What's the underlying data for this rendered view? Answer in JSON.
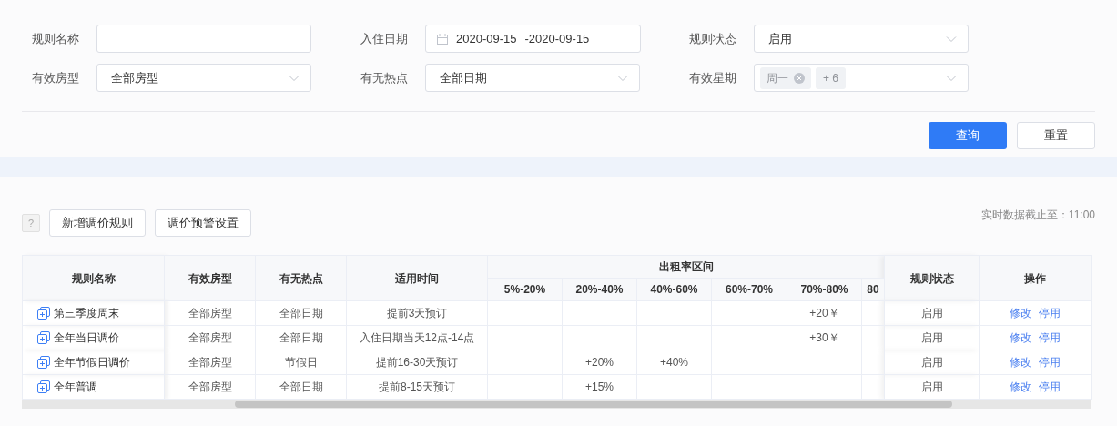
{
  "filters": [
    {
      "label": "规则名称",
      "kind": "text"
    },
    {
      "label": "入住日期",
      "kind": "daterange",
      "start": "2020-09-15",
      "separator": "-",
      "end": "2020-09-15"
    },
    {
      "label": "规则状态",
      "kind": "select",
      "value": "启用"
    },
    {
      "label": "有效房型",
      "kind": "select",
      "value": "全部房型"
    },
    {
      "label": "有无热点",
      "kind": "select",
      "value": "全部日期"
    },
    {
      "label": "有效星期",
      "kind": "tags",
      "tags": [
        "周一"
      ],
      "more": "+ 6"
    }
  ],
  "search_buttons": [
    {
      "label": "查询",
      "primary": true
    },
    {
      "label": "重置",
      "primary": false
    }
  ],
  "toolbar": {
    "help": "?",
    "buttons": [
      "新增调价规则",
      "调价预警设置"
    ],
    "timestamp": "实时数据截止至：11:00"
  },
  "table": {
    "left_columns": [
      "规则名称",
      "有效房型",
      "有无热点",
      "适用时间"
    ],
    "group": {
      "label": "出租率区间",
      "columns": [
        "5%-20%",
        "20%-40%",
        "40%-60%",
        "60%-70%",
        "70%-80%",
        "80"
      ]
    },
    "right_columns": [
      "规则状态",
      "操作"
    ],
    "rows": [
      {
        "name": "第三季度周末",
        "room_type": "全部房型",
        "hotspot": "全部日期",
        "time": "提前3天预订",
        "rates": {
          "col_5": "+20￥"
        },
        "status": "启用",
        "actions": [
          "修改",
          "停用"
        ]
      },
      {
        "name": "全年当日调价",
        "room_type": "全部房型",
        "hotspot": "全部日期",
        "time": "入住日期当天12点-14点",
        "rates": {
          "col_5": "+30￥"
        },
        "status": "启用",
        "actions": [
          "修改",
          "停用"
        ]
      },
      {
        "name": "全年节假日调价",
        "room_type": "全部房型",
        "hotspot": "节假日",
        "time": "提前16-30天预订",
        "rates": {
          "col_2": "+20%",
          "col_3": "+40%"
        },
        "status": "启用",
        "actions": [
          "修改",
          "停用"
        ]
      },
      {
        "name": "全年普调",
        "room_type": "全部房型",
        "hotspot": "全部日期",
        "time": "提前8-15天预订",
        "rates": {
          "col_2": "+15%"
        },
        "status": "启用",
        "actions": [
          "修改",
          "停用"
        ]
      }
    ]
  }
}
